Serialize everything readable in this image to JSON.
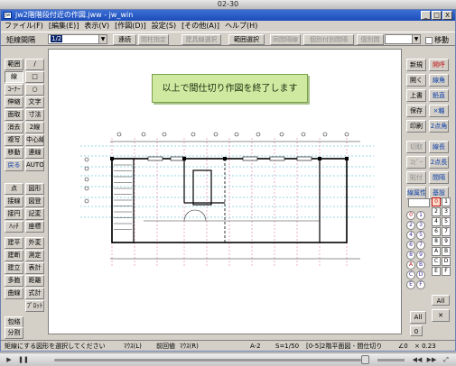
{
  "player": {
    "title": "02-30"
  },
  "window": {
    "title": "jw2階階段付近の作図.jww - jw_win",
    "icon_text": "jw",
    "buttons": {
      "minimize": "_",
      "maximize": "□",
      "close": "X"
    }
  },
  "menu": [
    "ファイル(F)",
    "[編集(E)]",
    "表示(V)",
    "[作図(D)]",
    "設定(S)",
    "[その他(A)]",
    "ヘルプ(H)"
  ],
  "toolbar": {
    "label": "矩線間隔",
    "select_value": "1/2",
    "buttons": [
      "連続",
      "間柱指定",
      "建具線選択",
      "範囲選択",
      "同間隔線",
      "個別付別間隔",
      "個別間"
    ],
    "check_label": "移動"
  },
  "left_tools": [
    [
      "範囲",
      "/"
    ],
    [
      "線",
      "□"
    ],
    [
      "ｺｰﾅｰ",
      "○"
    ],
    [
      "伸縮",
      "文字"
    ],
    [
      "面取",
      "寸法"
    ],
    [
      "消去",
      "2線"
    ],
    [
      "複写",
      "中心線"
    ],
    [
      "移動",
      "連線"
    ],
    [
      "戻る",
      "AUTO"
    ],
    [
      "点",
      "図形"
    ],
    [
      "接線",
      "図登"
    ],
    [
      "接円",
      "記変"
    ],
    [
      "ﾊｯﾁ",
      "座標"
    ],
    [
      "建平",
      "外変"
    ],
    [
      "建断",
      "測定"
    ],
    [
      "建立",
      "表計"
    ],
    [
      "多胞",
      "距離"
    ],
    [
      "曲線",
      "式計"
    ],
    [
      "",
      "ﾌﾟﾛｯﾄ"
    ],
    [
      "包絡",
      ""
    ],
    [
      "分割",
      ""
    ]
  ],
  "message": "以上で間仕切り作図を終了します",
  "right_tools": [
    [
      "新規",
      "開呼"
    ],
    [
      "開く",
      "線角"
    ],
    [
      "上書",
      "鉛直"
    ],
    [
      "保存",
      "×軸"
    ],
    [
      "印刷",
      "2点角"
    ],
    [
      "切取",
      "線長"
    ],
    [
      "ｺﾋﾟｰ",
      "2点長"
    ],
    [
      "貼付",
      "間隔"
    ],
    [
      "線属性",
      "基設"
    ]
  ],
  "layer_groups": [
    "0",
    "1",
    "2",
    "3",
    "4",
    "5",
    "6",
    "7",
    "8",
    "9",
    "A",
    "B",
    "C",
    "D",
    "E",
    "F"
  ],
  "layer_all": "All",
  "layer_zero": "0",
  "status": {
    "hint": "矩線にする図形を選択してください",
    "mouse_l": "ﾏｳｽ(L)",
    "mouse_label": "前回値",
    "mouse_r": "ﾏｳｽ(R)",
    "paper": "A-2",
    "scale": "S=1/50",
    "layer": "[0-5]2階平面図 - 間仕切り",
    "angle": "∠0",
    "zoom": "× 0.23"
  },
  "colors": {
    "accent": "#1c4cb8",
    "message_bg": "#cfeaa0",
    "grid": "#2bb3c8"
  }
}
